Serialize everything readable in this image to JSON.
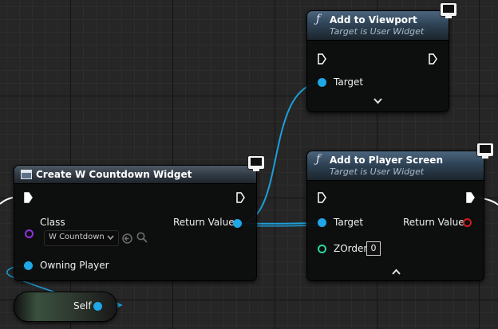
{
  "nodes": {
    "add_to_viewport": {
      "title": "Add to Viewport",
      "subtitle": "Target is User Widget",
      "function_icon": "function-icon",
      "target_label": "Target",
      "expand_icon": "chevron-down-icon"
    },
    "create_widget": {
      "title": "Create W Countdown Widget",
      "header_icon": "widget-icon",
      "class_label": "Class",
      "class_value": "W Countdown",
      "return_label": "Return Value",
      "owning_player_label": "Owning Player"
    },
    "add_to_player_screen": {
      "title": "Add to Player Screen",
      "subtitle": "Target is User Widget",
      "function_icon": "function-icon",
      "target_label": "Target",
      "return_label": "Return Value",
      "zorder_label": "ZOrder",
      "zorder_value": "0",
      "collapse_icon": "chevron-up-icon"
    },
    "self": {
      "label": "Self"
    }
  },
  "colors": {
    "object_pin": "#1fa7e6",
    "class_pin": "#8d33e0",
    "int_pin": "#26d6a4",
    "bool_pin": "#d21b1b",
    "exec_pin": "#ffffff"
  }
}
